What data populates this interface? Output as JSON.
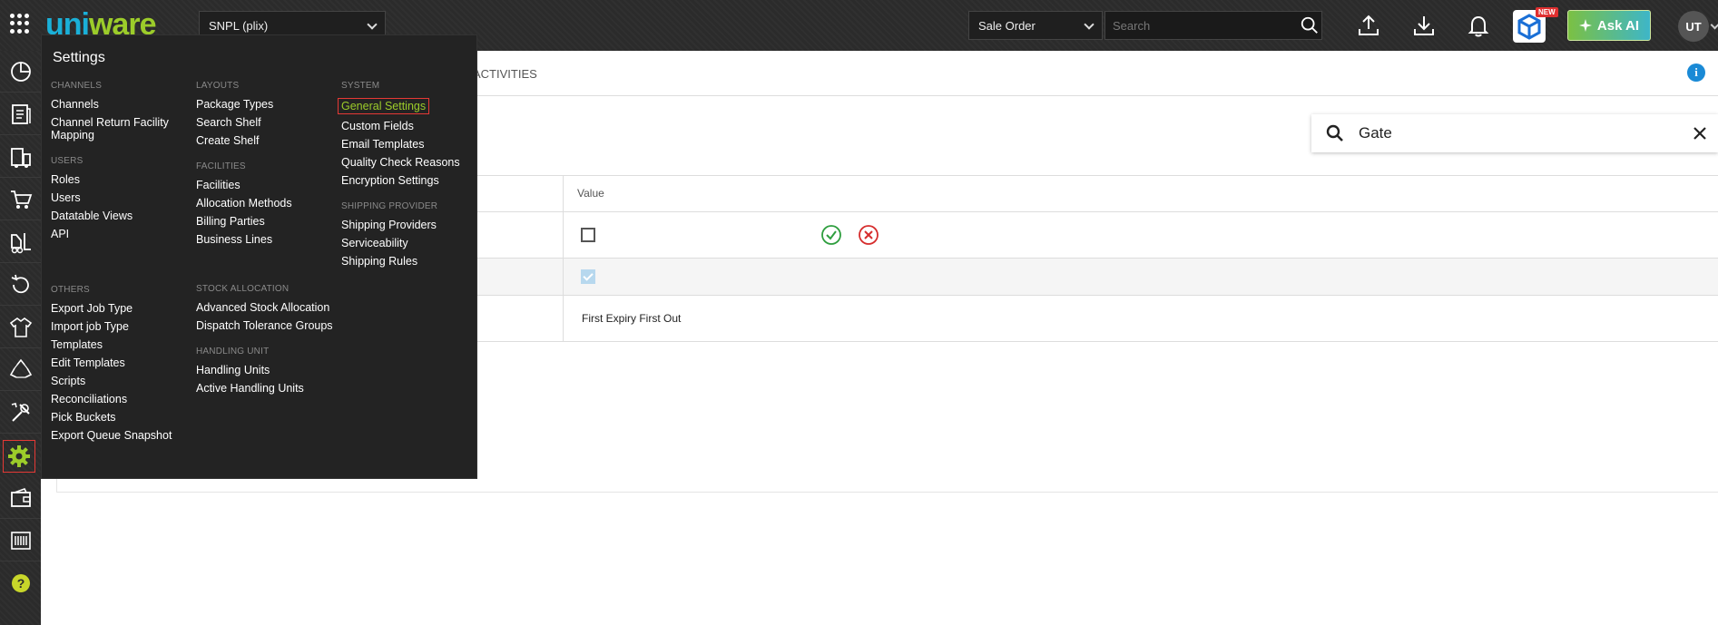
{
  "topbar": {
    "logo_part1": "uni",
    "logo_part2": "ware",
    "facility": "SNPL (plix)",
    "search_type": "Sale Order",
    "search_placeholder": "Search",
    "new_badge": "NEW",
    "ask_ai_label": "Ask AI",
    "user_initials": "UT"
  },
  "leftnav": {
    "icons": [
      "dashboard-icon",
      "orders-icon",
      "shipping-icon",
      "cart-icon",
      "forklift-icon",
      "returns-icon",
      "products-icon",
      "recycle-icon",
      "tools-icon",
      "settings-icon",
      "wallet-icon",
      "barcode-icon",
      "help-icon"
    ],
    "active": "settings-icon"
  },
  "main": {
    "activities_tab": "ACTIVITIES",
    "filter_value": "Gate",
    "table": {
      "value_header": "Value",
      "row3_value": "First Expiry First Out"
    }
  },
  "settings_menu": {
    "title": "Settings",
    "channels": {
      "heading": "CHANNELS",
      "items": [
        "Channels",
        "Channel Return Facility Mapping"
      ]
    },
    "users": {
      "heading": "USERS",
      "items": [
        "Roles",
        "Users",
        "Datatable Views",
        "API"
      ]
    },
    "others": {
      "heading": "OTHERS",
      "items": [
        "Export Job Type",
        "Import job Type",
        "Templates",
        "Edit Templates",
        "Scripts",
        "Reconciliations",
        "Pick Buckets",
        "Export Queue Snapshot"
      ]
    },
    "layouts": {
      "heading": "LAYOUTS",
      "items": [
        "Package Types",
        "Search Shelf",
        "Create Shelf"
      ]
    },
    "facilities": {
      "heading": "FACILITIES",
      "items": [
        "Facilities",
        "Allocation Methods",
        "Billing Parties",
        "Business Lines"
      ]
    },
    "stock_allocation": {
      "heading": "STOCK ALLOCATION",
      "items": [
        "Advanced Stock Allocation",
        "Dispatch Tolerance Groups"
      ]
    },
    "handling_unit": {
      "heading": "HANDLING UNIT",
      "items": [
        "Handling Units",
        "Active Handling Units"
      ]
    },
    "system": {
      "heading": "SYSTEM",
      "items": [
        "General Settings",
        "Custom Fields",
        "Email Templates",
        "Quality Check Reasons",
        "Encryption Settings"
      ]
    },
    "shipping_provider": {
      "heading": "SHIPPING PROVIDER",
      "items": [
        "Shipping Providers",
        "Serviceability",
        "Shipping Rules"
      ]
    }
  },
  "colors": {
    "brand_blue": "#1ab0d8",
    "brand_green": "#9ccc2a",
    "highlight_border": "#e53935",
    "info_blue": "#1a8ad6"
  }
}
